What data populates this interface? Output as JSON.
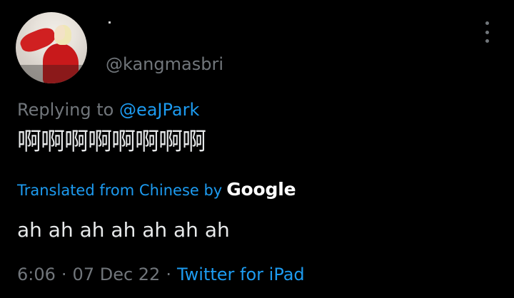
{
  "colors": {
    "background": "#000000",
    "text_primary": "#e7e9ea",
    "text_secondary": "#71767b",
    "accent": "#1d9bf0"
  },
  "tweet": {
    "author_name": ".",
    "handle": "@kangmasbri",
    "replying_prefix": "Replying to",
    "reply_to": "@eaJPark",
    "original_text": "啊啊啊啊啊啊啊啊",
    "translation_prefix": "Translated from Chinese by",
    "translation_provider": "Google",
    "translated_text": "ah ah ah ah ah ah ah",
    "time": "6:06",
    "date": "07 Dec 22",
    "source": "Twitter for iPad",
    "separator": "·"
  },
  "icons": {
    "more": "more-vertical-icon",
    "avatar": "user-avatar"
  }
}
